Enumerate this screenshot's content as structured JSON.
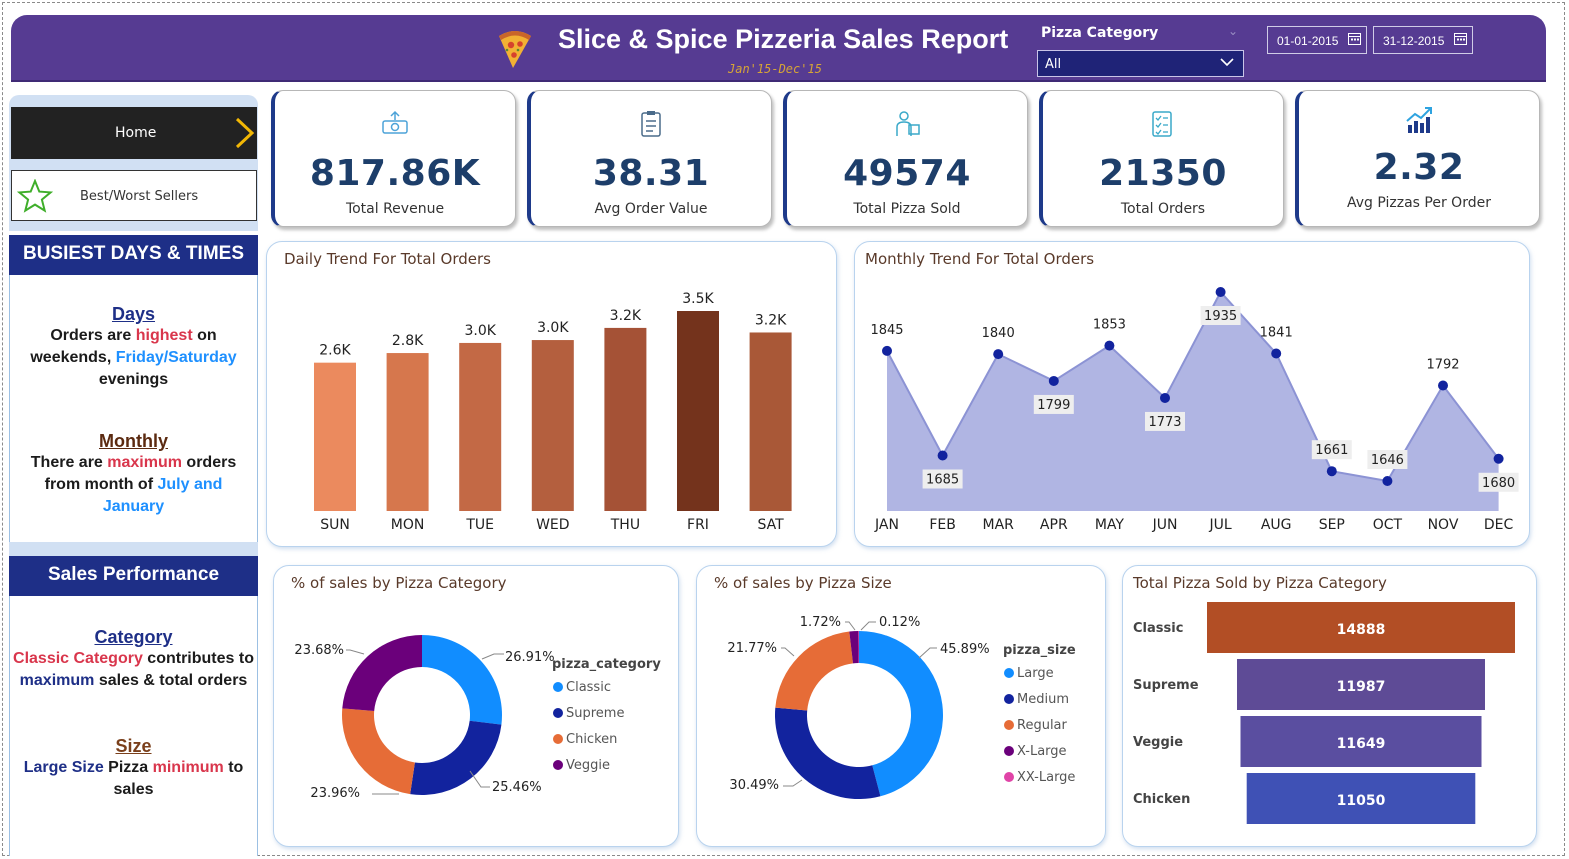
{
  "header": {
    "title": "Slice & Spice Pizzeria Sales Report",
    "subtitle": "Jan'15-Dec'15",
    "filter_label": "Pizza Category",
    "filter_value": "All",
    "date_from": "01-01-2015",
    "date_to": "31-12-2015"
  },
  "nav": {
    "home": "Home",
    "best_worst": "Best/Worst Sellers"
  },
  "busiest": {
    "heading": "BUSIEST DAYS & TIMES",
    "days_h": "Days",
    "days_1": "Orders are ",
    "days_2": "highest",
    "days_3": " on weekends, ",
    "days_4": "Friday/Saturday",
    "days_5": " evenings",
    "monthly_h": "Monthly",
    "monthly_1": "There are ",
    "monthly_2": "maximum",
    "monthly_3": " orders from month of ",
    "monthly_4": "July and January"
  },
  "sales_perf": {
    "heading": "Sales Performance",
    "cat_h": "Category",
    "cat_1": "Classic Category",
    "cat_2": " contributes to ",
    "cat_3": "maximum",
    "cat_4": " sales & total orders",
    "size_h": "Size",
    "size_1": "Large Size",
    "size_2": " Pizza ",
    "size_3": "minimum",
    "size_4": " to sales"
  },
  "kpis": [
    {
      "value": "817.86K",
      "label": "Total Revenue",
      "icon": "money-icon"
    },
    {
      "value": "38.31",
      "label": "Avg Order Value",
      "icon": "clipboard-icon"
    },
    {
      "value": "49574",
      "label": "Total Pizza Sold",
      "icon": "delivery-icon"
    },
    {
      "value": "21350",
      "label": "Total Orders",
      "icon": "checklist-icon"
    },
    {
      "value": "2.32",
      "label": "Avg Pizzas Per Order",
      "icon": "growth-chart-icon"
    }
  ],
  "colors": {
    "header": "#563b92",
    "kpi_value": "#1d3e6a",
    "sidebar_heading": "#1e2f87"
  },
  "chart_data": [
    {
      "type": "bar",
      "title": "Daily Trend For Total Orders",
      "categories": [
        "SUN",
        "MON",
        "TUE",
        "WED",
        "THU",
        "FRI",
        "SAT"
      ],
      "values": [
        2624,
        2794,
        2973,
        3024,
        3239,
        3538,
        3158
      ],
      "labels": [
        "2.6K",
        "2.8K",
        "3.0K",
        "3.0K",
        "3.2K",
        "3.5K",
        "3.2K"
      ],
      "colors": [
        "#eb8a5e",
        "#d6774d",
        "#c36945",
        "#b45f3e",
        "#a55236",
        "#74331c",
        "#a95837"
      ]
    },
    {
      "type": "area",
      "title": "Monthly Trend For Total Orders",
      "categories": [
        "JAN",
        "FEB",
        "MAR",
        "APR",
        "MAY",
        "JUN",
        "JUL",
        "AUG",
        "SEP",
        "OCT",
        "NOV",
        "DEC"
      ],
      "values": [
        1845,
        1685,
        1840,
        1799,
        1853,
        1773,
        1935,
        1841,
        1661,
        1646,
        1792,
        1680
      ]
    },
    {
      "type": "pie",
      "title": "% of sales by Pizza Category",
      "legend_title": "pizza_category",
      "categories": [
        "Classic",
        "Supreme",
        "Chicken",
        "Veggie"
      ],
      "values": [
        26.91,
        25.46,
        23.96,
        23.68
      ],
      "labels": [
        "26.91%",
        "25.46%",
        "23.96%",
        "23.68%"
      ],
      "colors": [
        "#118dff",
        "#12239e",
        "#e66c37",
        "#6b007b"
      ]
    },
    {
      "type": "pie",
      "title": "% of sales by Pizza Size",
      "legend_title": "pizza_size",
      "categories": [
        "Large",
        "Medium",
        "Regular",
        "X-Large",
        "XX-Large"
      ],
      "values": [
        45.89,
        30.49,
        21.77,
        1.72,
        0.12
      ],
      "labels": [
        "45.89%",
        "30.49%",
        "21.77%",
        "1.72%",
        "0.12%"
      ],
      "colors": [
        "#118dff",
        "#12239e",
        "#e66c37",
        "#6b007b",
        "#e044a7"
      ]
    },
    {
      "type": "bar",
      "title": "Total Pizza Sold by Pizza Category",
      "categories": [
        "Classic",
        "Supreme",
        "Veggie",
        "Chicken"
      ],
      "values": [
        14888,
        11987,
        11649,
        11050
      ],
      "colors": [
        "#b24e25",
        "#5e4b96",
        "#5a4ea0",
        "#3f51b5"
      ]
    }
  ]
}
